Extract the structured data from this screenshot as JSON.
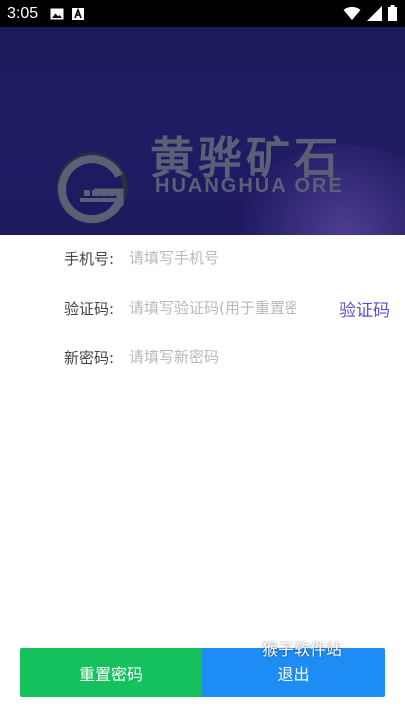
{
  "status_bar": {
    "time": "3:05",
    "left_icons": [
      "image-icon",
      "text-a-icon"
    ],
    "right_icons": [
      "wifi-icon",
      "signal-icon",
      "battery-icon"
    ]
  },
  "banner": {
    "brand_cn": "黄骅矿石",
    "brand_en": "HUANGHUA ORE",
    "colors": {
      "background": "#1e1b60",
      "brand_text": "#5c6077"
    }
  },
  "form": {
    "phone": {
      "label": "手机号:",
      "placeholder": "请填写手机号",
      "value": ""
    },
    "code": {
      "label": "验证码:",
      "placeholder": "请填写验证码(用于重置密码)",
      "value": "",
      "link_label": "验证码"
    },
    "new_password": {
      "label": "新密码:",
      "placeholder": "请填写新密码",
      "value": ""
    }
  },
  "actions": {
    "reset_label": "重置密码",
    "exit_label": "退出",
    "colors": {
      "reset": "#14c15c",
      "exit": "#1d8cf5",
      "link": "#5a4fd6"
    }
  },
  "watermark": "猴子软件站"
}
